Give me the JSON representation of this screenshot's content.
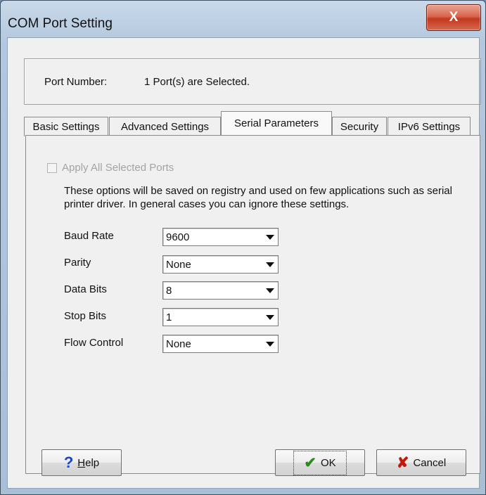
{
  "window": {
    "title": "COM Port Setting",
    "close_glyph": "X"
  },
  "port": {
    "label": "Port Number:",
    "value": "1 Port(s) are Selected."
  },
  "tabs": [
    {
      "label": "Basic Settings",
      "active": false
    },
    {
      "label": "Advanced Settings",
      "active": false
    },
    {
      "label": "Serial Parameters",
      "active": true
    },
    {
      "label": "Security",
      "active": false
    },
    {
      "label": "IPv6 Settings",
      "active": false
    }
  ],
  "apply_all": {
    "label": "Apply All Selected Ports",
    "checked": false,
    "disabled": true
  },
  "description": "These options will be saved on registry and used on few applications such as serial printer driver. In general cases you can ignore these settings.",
  "fields": [
    {
      "label": "Baud Rate",
      "value": "9600"
    },
    {
      "label": "Parity",
      "value": "None"
    },
    {
      "label": "Data Bits",
      "value": "8"
    },
    {
      "label": "Stop Bits",
      "value": "1"
    },
    {
      "label": "Flow Control",
      "value": "None"
    }
  ],
  "buttons": {
    "help_prefix": "",
    "help_accel": "H",
    "help_rest": "elp",
    "help_icon": "?",
    "ok": "OK",
    "ok_icon": "✔",
    "cancel": "Cancel",
    "cancel_icon": "✘"
  },
  "icons": {
    "help": "question-mark-icon",
    "ok": "checkmark-icon",
    "cancel": "x-mark-icon",
    "dropdown": "chevron-down-icon"
  },
  "colors": {
    "help_icon": "#1a45c8",
    "ok_icon": "#2c8a1e",
    "cancel_icon": "#c5180c",
    "close_button": "#c2381f"
  }
}
